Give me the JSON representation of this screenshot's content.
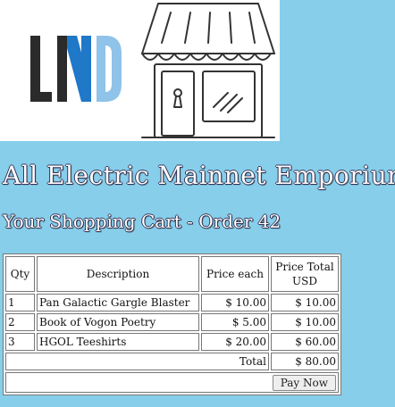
{
  "logo": {
    "icon": "lnd-logo-icon",
    "colors": {
      "dark": "#2b2b2b",
      "blue": "#1f78c8",
      "light_blue": "#8fc3ea"
    }
  },
  "storefront": {
    "icon": "storefront-icon"
  },
  "store_title": "All Electric Mainnet Emporium",
  "cart_title": "Your Shopping Cart - Order 42",
  "table": {
    "headers": [
      "Qty",
      "Description",
      "Price each",
      "Price Total USD"
    ],
    "rows": [
      {
        "qty": "1",
        "description": "Pan Galactic Gargle Blaster",
        "price_each": "$ 10.00",
        "price_total": "$ 10.00"
      },
      {
        "qty": "2",
        "description": "Book of Vogon Poetry",
        "price_each": "$ 5.00",
        "price_total": "$ 10.00"
      },
      {
        "qty": "3",
        "description": "HGOL Teeshirts",
        "price_each": "$ 20.00",
        "price_total": "$ 60.00"
      }
    ],
    "total_label": "Total",
    "total_value": "$ 80.00"
  },
  "pay_button": "Pay Now",
  "colors": {
    "page_background": "#87ceeb",
    "banner_background": "#ffffff",
    "heading_text": "#ffffff"
  }
}
